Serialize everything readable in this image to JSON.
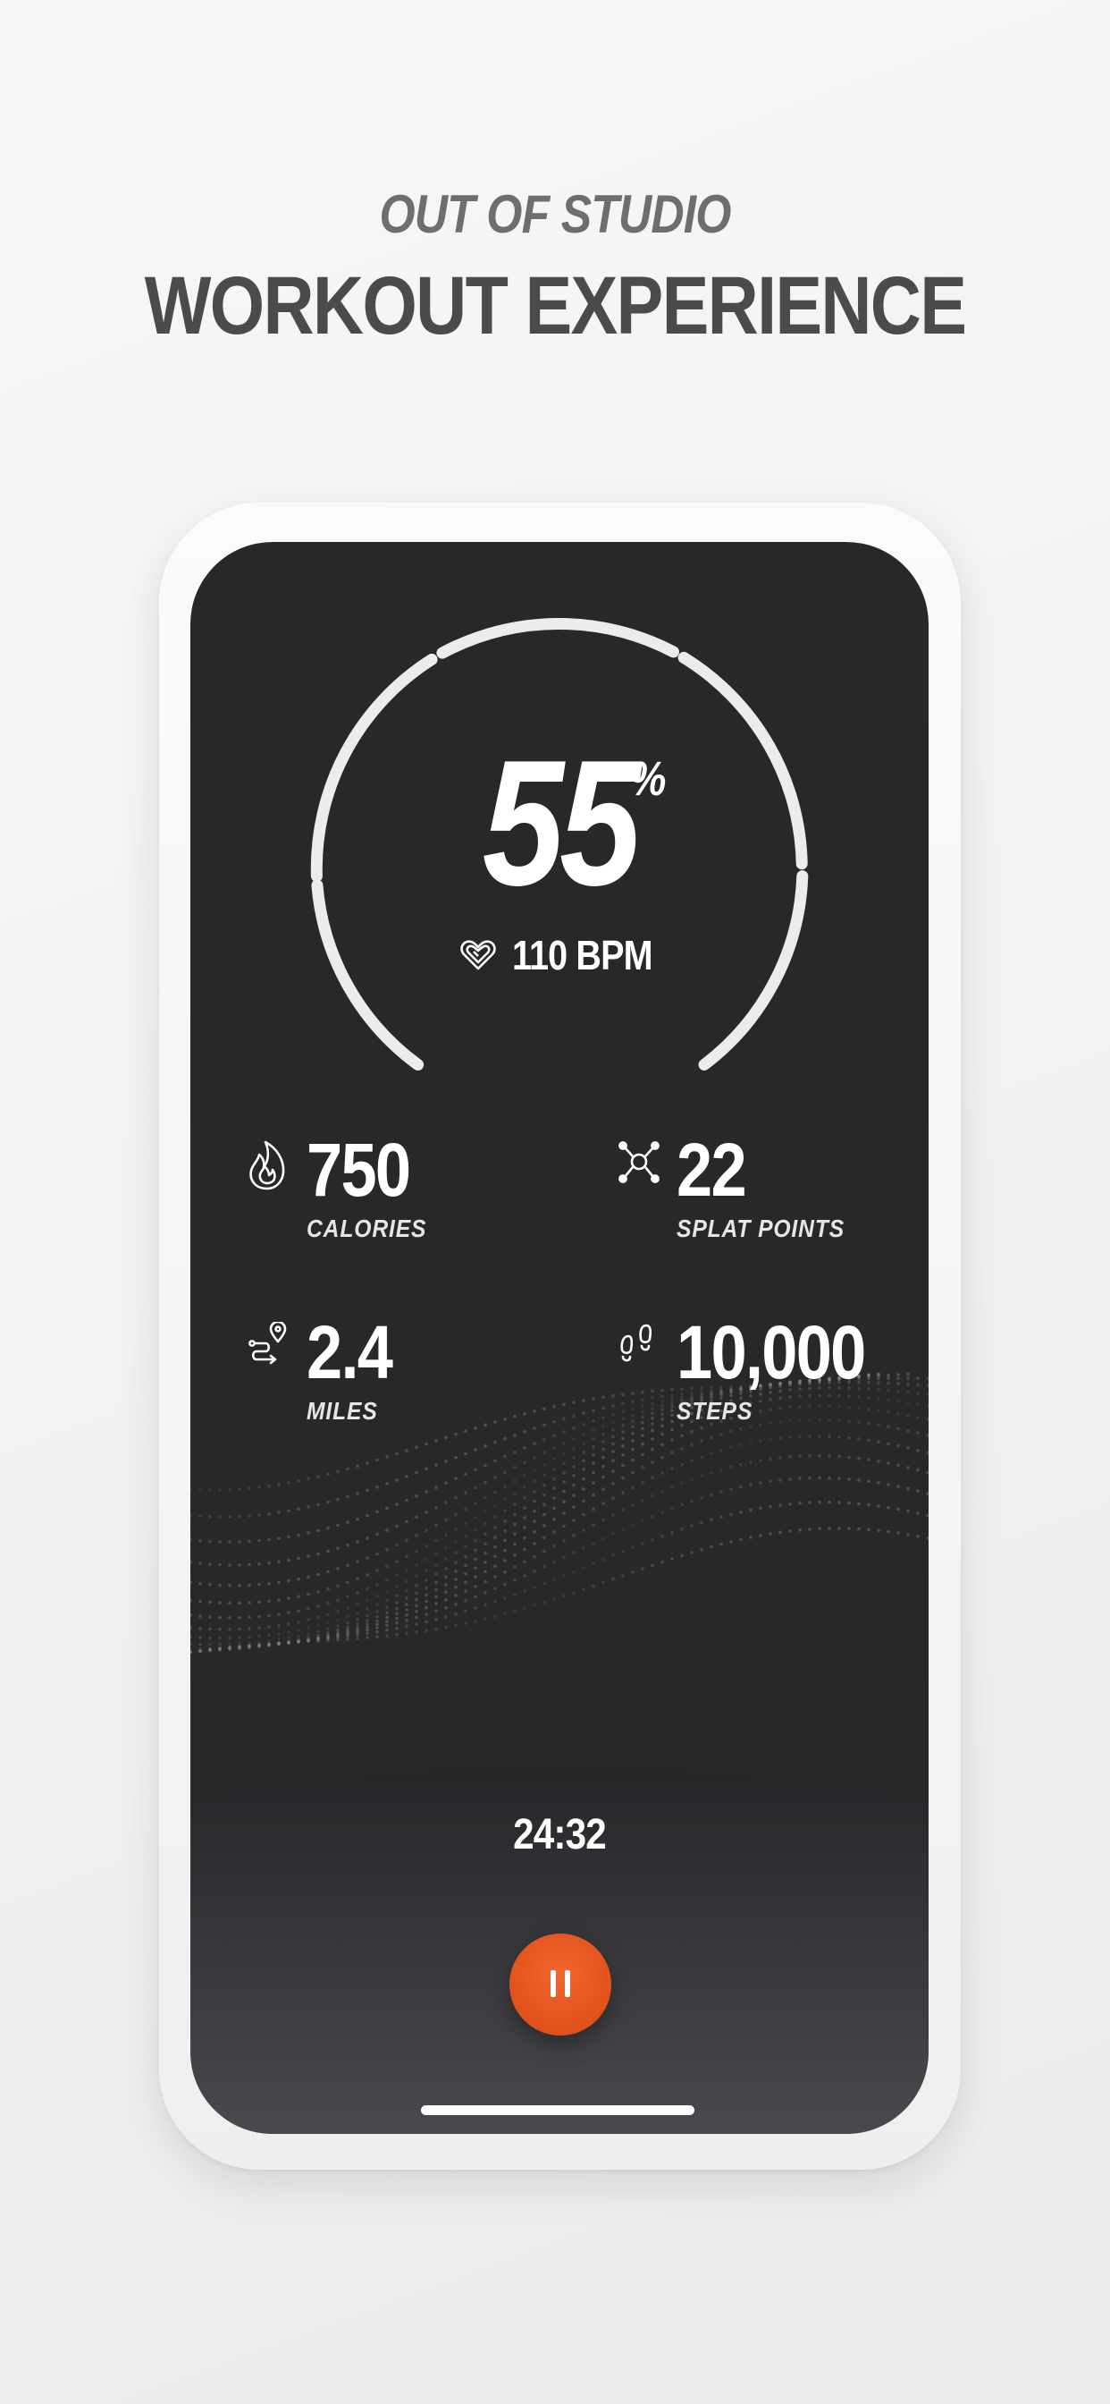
{
  "header": {
    "subtitle": "OUT OF STUDIO",
    "title": "WORKOUT EXPERIENCE"
  },
  "gauge": {
    "percent_value": "55",
    "percent_sign": "%",
    "heart_rate": "110 BPM",
    "heart_icon": "heart-rate-icon"
  },
  "stats": [
    {
      "value": "750",
      "label": "CALORIES",
      "icon": "flame-icon"
    },
    {
      "value": "22",
      "label": "SPLAT POINTS",
      "icon": "splat-icon"
    },
    {
      "value": "2.4",
      "label": "MILES",
      "icon": "route-icon"
    },
    {
      "value": "10,000",
      "label": "STEPS",
      "icon": "footprints-icon"
    }
  ],
  "workout": {
    "timer": "24:32",
    "pause_icon": "pause-icon"
  },
  "colors": {
    "screen_bg": "#282828",
    "accent": "#e85a23",
    "text_dark": "#4b4b4d",
    "text_muted": "#6e6e70"
  }
}
